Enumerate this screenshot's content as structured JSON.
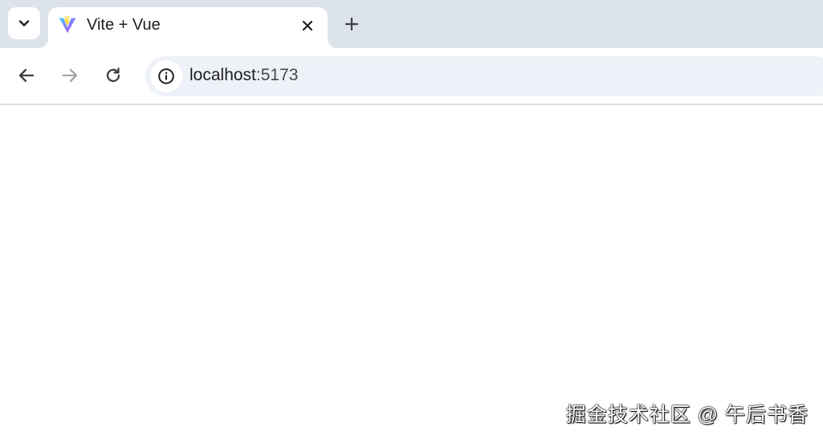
{
  "browser": {
    "tab": {
      "title": "Vite + Vue",
      "favicon": "vite-logo-icon"
    },
    "tab_search_icon": "chevron-down-icon",
    "close_icon": "close-icon",
    "new_tab_icon": "plus-icon",
    "toolbar": {
      "back_icon": "arrow-left-icon",
      "forward_icon": "arrow-right-icon",
      "reload_icon": "reload-icon",
      "site_info_icon": "info-icon"
    },
    "address": {
      "host": "localhost",
      "port": ":5173"
    }
  },
  "page": {
    "watermark": "掘金技术社区 @ 午后书香"
  },
  "colors": {
    "tabstrip": "#dde3ea",
    "omnibox": "#eef2f8",
    "forward_disabled": "#a0a4a8"
  }
}
